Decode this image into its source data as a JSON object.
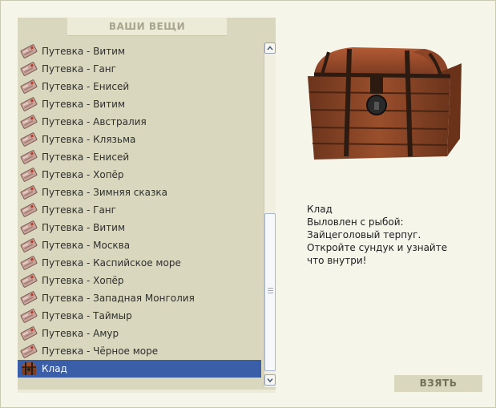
{
  "panel": {
    "title": "ВАШИ ВЕЩИ"
  },
  "items": [
    {
      "label": "Путевка - Витим",
      "icon": "voucher-icon"
    },
    {
      "label": "Путевка - Ганг",
      "icon": "voucher-icon"
    },
    {
      "label": "Путевка - Енисей",
      "icon": "voucher-icon"
    },
    {
      "label": "Путевка - Витим",
      "icon": "voucher-icon"
    },
    {
      "label": "Путевка - Австралия",
      "icon": "voucher-icon"
    },
    {
      "label": "Путевка - Клязьма",
      "icon": "voucher-icon"
    },
    {
      "label": "Путевка - Енисей",
      "icon": "voucher-icon"
    },
    {
      "label": "Путевка - Хопёр",
      "icon": "voucher-icon"
    },
    {
      "label": "Путевка - Зимняя сказка",
      "icon": "voucher-icon"
    },
    {
      "label": "Путевка - Ганг",
      "icon": "voucher-icon"
    },
    {
      "label": "Путевка - Витим",
      "icon": "voucher-icon"
    },
    {
      "label": "Путевка - Москва",
      "icon": "voucher-icon"
    },
    {
      "label": "Путевка - Каспийское море",
      "icon": "voucher-icon"
    },
    {
      "label": "Путевка - Хопёр",
      "icon": "voucher-icon"
    },
    {
      "label": "Путевка - Западная Монголия",
      "icon": "voucher-icon"
    },
    {
      "label": "Путевка - Таймыр",
      "icon": "voucher-icon"
    },
    {
      "label": "Путевка - Амур",
      "icon": "voucher-icon"
    },
    {
      "label": "Путевка - Чёрное море",
      "icon": "voucher-icon"
    },
    {
      "label": "Клад",
      "icon": "treasure-chest-icon",
      "selected": true
    }
  ],
  "detail": {
    "image": "treasure-chest",
    "lines": [
      "Клад",
      "Выловлен с рыбой:",
      "Зайцеголовый терпуг.",
      "Откройте сундук и узнайте",
      "что внутри!"
    ]
  },
  "actions": {
    "take_label": "ВЗЯТЬ"
  },
  "colors": {
    "panel_bg": "#d9d8bf",
    "selection": "#3a5fa8",
    "page_bg": "#f5f5ea"
  }
}
